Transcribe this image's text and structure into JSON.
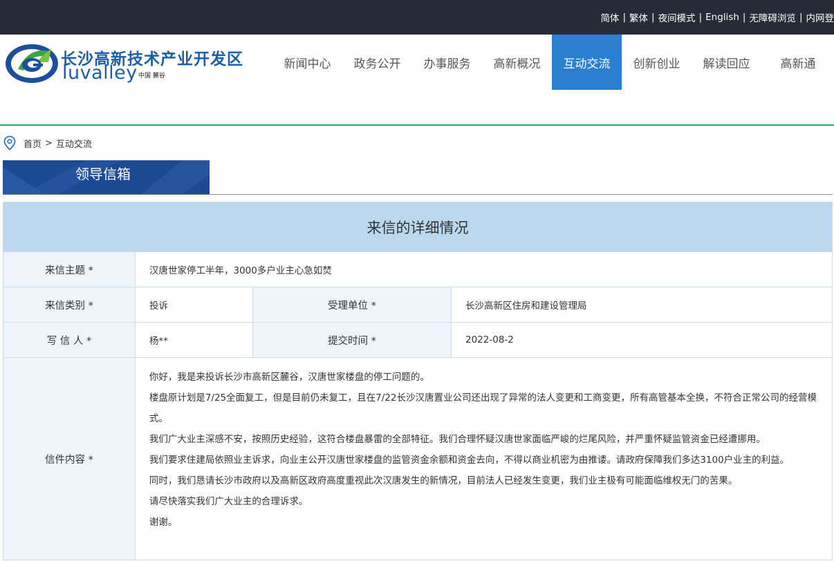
{
  "topbar": {
    "links": [
      "简体",
      "繁体",
      "夜间模式",
      "English",
      "无障碍浏览",
      "内网登"
    ]
  },
  "logo": {
    "title": "长沙高新技术产业开发区",
    "subtitle": "luvalley",
    "tagline": "中国 麓谷"
  },
  "nav": {
    "items": [
      "新闻中心",
      "政务公开",
      "办事服务",
      "高新概况",
      "互动交流",
      "创新创业",
      "解读回应",
      "高新通"
    ],
    "active_index": 4
  },
  "breadcrumb": {
    "home": "首页",
    "separator": ">",
    "current": "互动交流"
  },
  "section": {
    "title": "领导信箱"
  },
  "letter": {
    "heading": "来信的详细情况",
    "subject_label": "来信主题 *",
    "subject": "汉唐世家停工半年，3000多户业主心急如焚",
    "category_label": "来信类别 *",
    "category": "投诉",
    "dept_label": "受理单位 *",
    "dept": "长沙高新区住房和建设管理局",
    "writer_label": "写 信 人 *",
    "writer": "杨**",
    "time_label": "提交时间 *",
    "time": "2022-08-2",
    "content_label": "信件内容 *",
    "content_lines": [
      "你好，我是来投诉长沙市高新区麓谷，汉唐世家楼盘的停工问题的。",
      "楼盘原计划是7/25全面复工，但是目前仍未复工，且在7/22长沙汉唐置业公司还出现了异常的法人变更和工商变更，所有高管基本全换，不符合正常公司的经营模式。",
      "我们广大业主深感不安，按照历史经验，这符合楼盘暴雷的全部特征。我们合理怀疑汉唐世家面临严峻的烂尾风险，并严重怀疑监管资金已经遭挪用。",
      "我们要求住建局依照业主诉求，向业主公开汉唐世家楼盘的监管资金余额和资金去向，不得以商业机密为由推诿。请政府保障我们多达3100户业主的利益。",
      "同时，我们恳请长沙市政府以及高新区政府高度重视此次汉唐发生的新情况，目前法人已经发生变更，我们业主极有可能面临维权无门的苦果。",
      "请尽快落实我们广大业主的合理诉求。",
      "谢谢。"
    ]
  },
  "colors": {
    "topbar": "#252c37",
    "nav_active": "#2b7fd1",
    "banner": "#1c4a92",
    "table_head": "#bcd8ee",
    "label_bg": "#edf4fa",
    "divider": "#3aa56b"
  }
}
